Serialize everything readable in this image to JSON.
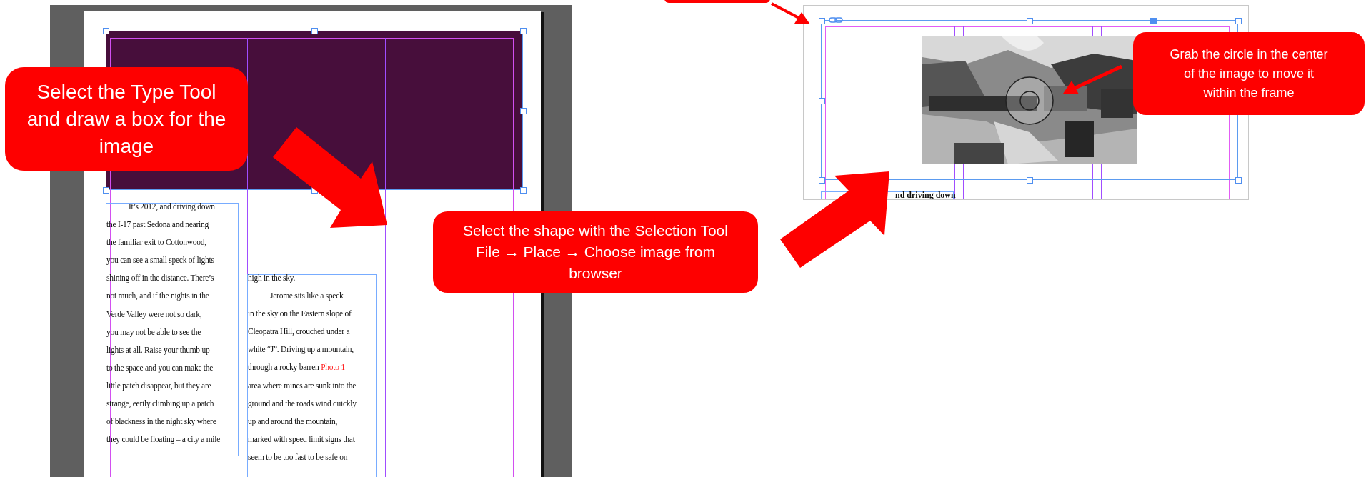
{
  "left_document": {
    "columns": [
      {
        "paragraphs": [
          {
            "indent": true,
            "lines": [
              "It’s 2012, and driving down",
              "the I-17 past Sedona and nearing",
              "the familiar exit to Cottonwood,",
              "you can see a small speck of lights",
              "shining off in the distance. There’s",
              "not much, and if the nights in the",
              "Verde Valley were not so dark,",
              "you may not be able to see the",
              "lights at all. Raise your thumb up",
              "to the space and you can make the",
              "little patch disappear, but they are",
              "strange, eerily climbing up a patch",
              "of blackness in the night sky where",
              "they could be floating – a city a mile"
            ]
          }
        ]
      },
      {
        "paragraphs": [
          {
            "indent": false,
            "lines": [
              "high in the sky."
            ]
          },
          {
            "indent": true,
            "lines": [
              "Jerome sits like a speck",
              "in the sky on the Eastern slope of",
              "Cleopatra Hill, crouched under a",
              "white “J”. Driving up a mountain,",
              {
                "text": "through a rocky barren ",
                "marker": "Photo 1"
              },
              "area where mines are sunk into the",
              "ground and the roads wind quickly",
              "up and around the mountain,",
              "marked with speed limit signs that",
              "seem to be too fast to be safe on"
            ]
          }
        ]
      }
    ]
  },
  "right_document": {
    "text_line": "nd driving down"
  },
  "callouts": [
    {
      "lines": [
        "Select the Type Tool",
        "and draw a box for the",
        "image"
      ]
    },
    {
      "lines": [
        "Select the shape with the Selection Tool",
        "File → Place → Choose image from",
        "browser"
      ]
    },
    {
      "lines": [
        "Grab the circle in the center",
        "of the image to move it",
        "within the frame"
      ]
    }
  ]
}
